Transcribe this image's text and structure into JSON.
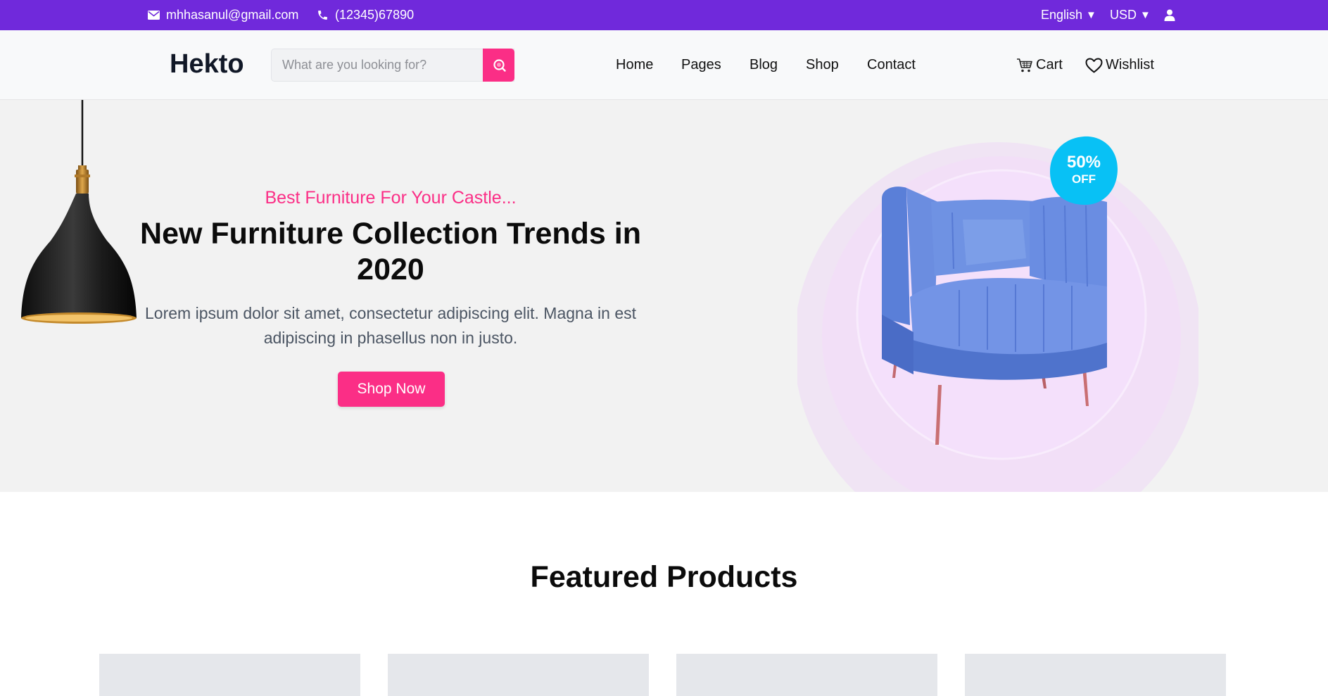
{
  "topbar": {
    "email": "mhhasanul@gmail.com",
    "phone": "(12345)67890",
    "language": "English",
    "currency": "USD",
    "icons": [
      "mail-icon",
      "phone-icon",
      "user-icon"
    ]
  },
  "header": {
    "logo": "Hekto",
    "search_placeholder": "What are you looking for?",
    "nav": [
      "Home",
      "Pages",
      "Blog",
      "Shop",
      "Contact"
    ],
    "cart_label": "Cart",
    "wishlist_label": "Wishlist"
  },
  "hero": {
    "subtitle": "Best Furniture For Your Castle...",
    "title": "New Furniture Collection Trends in 2020",
    "description": "Lorem ipsum dolor sit amet, consectetur adipiscing elit. Magna in est adipiscing in phasellus non in justo.",
    "button": "Shop Now",
    "badge_percent": "50%",
    "badge_off": "OFF"
  },
  "featured": {
    "title": "Featured Products"
  },
  "colors": {
    "topbar": "#7029db",
    "accent": "#fb2e86",
    "badge": "#08c1f5"
  }
}
